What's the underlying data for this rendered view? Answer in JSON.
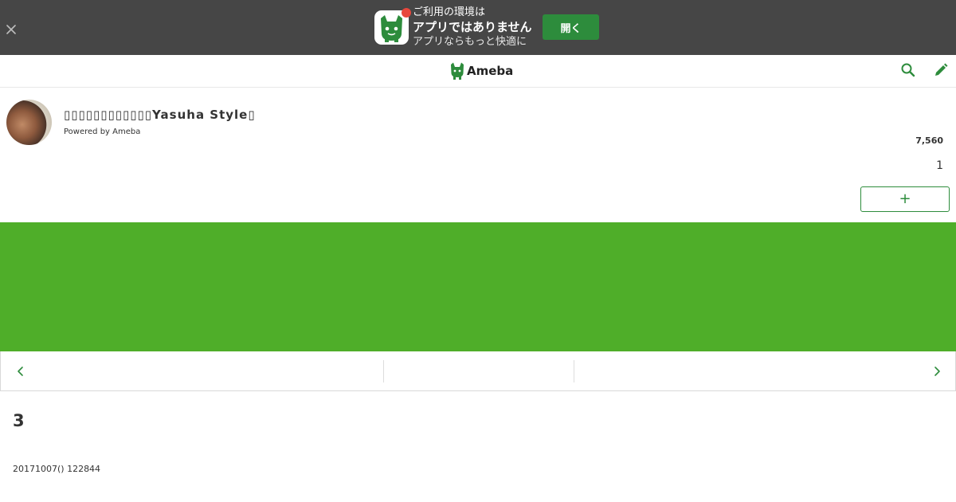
{
  "app_banner": {
    "close_icon": "close-icon",
    "line1": "ご利用の環境は",
    "line2": "アプリではありません",
    "line3": "アプリならもっと快適に",
    "open_label": "開く",
    "colors": {
      "background": "#464646",
      "button": "#2d8c3c",
      "dot": "#e8473c"
    }
  },
  "header": {
    "logo_text": "Ameba",
    "search_icon": "search-icon",
    "edit_icon": "pencil-icon",
    "brand_color": "#2d8c3c"
  },
  "blog": {
    "title": "▯▯▯▯▯▯▯▯▯▯▯▯Yasuha Style▯",
    "powered_by": "Powered by Ameba",
    "reader_count": "7,560",
    "small_count": "1",
    "follow_label": "+"
  },
  "banner_area": {
    "color": "#4fae29"
  },
  "pager": {
    "prev_icon": "chevron-left-icon",
    "next_icon": "chevron-right-icon"
  },
  "entry": {
    "title": "3",
    "date": "20171007() 122844"
  }
}
